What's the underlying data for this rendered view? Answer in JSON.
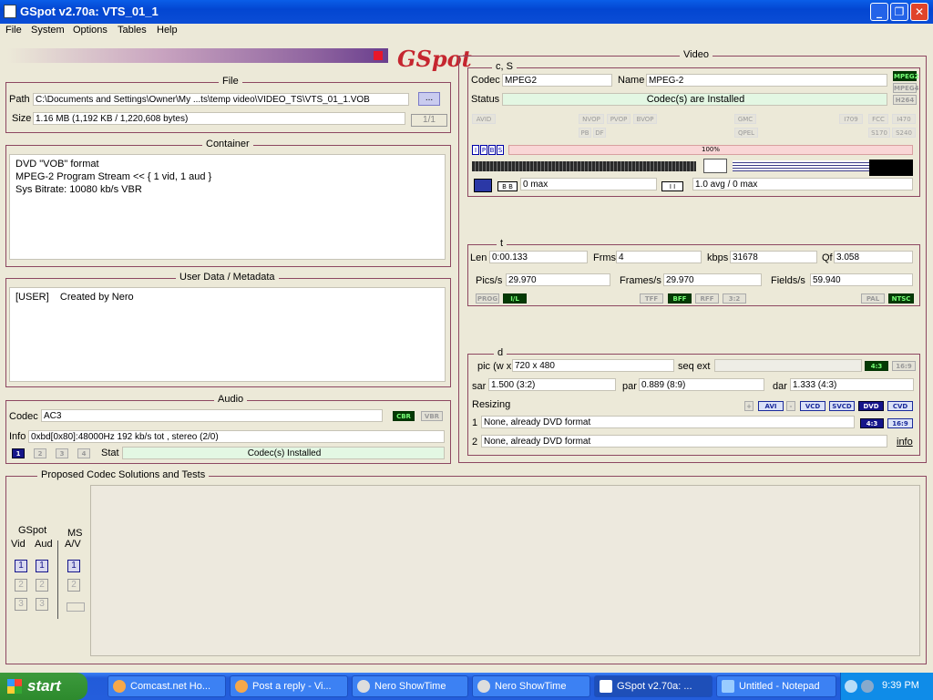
{
  "window": {
    "title": "GSpot v2.70a: VTS_01_1",
    "min": "_",
    "max": "❐",
    "close": "✕"
  },
  "menu": [
    "File",
    "System",
    "Options",
    "Tables",
    "Help"
  ],
  "logo": "GSpot",
  "file": {
    "title": "File",
    "path_label": "Path",
    "path": "C:\\Documents and Settings\\Owner\\My ...ts\\temp video\\VIDEO_TS\\VTS_01_1.VOB",
    "browse": "...",
    "size_label": "Size",
    "size": "1.16 MB (1,192 KB / 1,220,608 bytes)",
    "counter": "1/1"
  },
  "container": {
    "title": "Container",
    "text": "DVD \"VOB\" format\nMPEG-2 Program Stream << { 1 vid, 1 aud }\nSys Bitrate: 10080 kb/s VBR"
  },
  "userdata": {
    "title": "User Data / Metadata",
    "text": "[USER]    Created by Nero"
  },
  "audio": {
    "title": "Audio",
    "codec_label": "Codec",
    "codec": "AC3",
    "cbr": "CBR",
    "vbr": "VBR",
    "info_label": "Info",
    "info": "0xbd[0x80]:48000Hz  192 kb/s tot , stereo (2/0)",
    "stat_label": "Stat",
    "stat": "Codec(s) Installed",
    "tracks": [
      "1",
      "2",
      "3",
      "4"
    ]
  },
  "codec_solutions": {
    "title": "Proposed Codec Solutions and Tests",
    "gspot": "GSpot",
    "vid": "Vid",
    "aud": "Aud",
    "ms": "MS",
    "av": "A/V",
    "btns": [
      "1",
      "2",
      "3"
    ]
  },
  "video": {
    "title": "Video",
    "cs_title": "c, S",
    "codec_label": "Codec",
    "codec": "MPEG2",
    "name_label": "Name",
    "name": "MPEG-2",
    "status_label": "Status",
    "status": "Codec(s) are Installed",
    "fmt": [
      "MPEG2",
      "MPEG4",
      "H264"
    ],
    "flags1": [
      "AVID",
      "NVOP",
      "PVOP",
      "BVOP",
      "GMC",
      "I709",
      "FCC",
      "I470"
    ],
    "flags2": [
      "PB",
      "DF",
      "QPEL",
      "S170",
      "S240"
    ],
    "frame_types": [
      "I",
      "P",
      "B",
      "S"
    ],
    "percent": "100%",
    "be": "B B",
    "max1": "0 max",
    "ii": "I I",
    "avg": "1.0 avg / 0 max"
  },
  "timing": {
    "title": "t",
    "len_label": "Len",
    "len": "0:00.133",
    "frms_label": "Frms",
    "frms": "4",
    "kbps_label": "kbps",
    "kbps": "31678",
    "qf_label": "Qf",
    "qf": "3.058",
    "pics_label": "Pics/s",
    "pics": "29.970",
    "frames_label": "Frames/s",
    "frames": "29.970",
    "fields_label": "Fields/s",
    "fields": "59.940",
    "flags": [
      "PROG",
      "I/L",
      "TFF",
      "BFF",
      "RFF",
      "3:2",
      "PAL",
      "NTSC"
    ]
  },
  "dims": {
    "title": "d",
    "pic_label": "pic (w x h)",
    "pic": "720 x 480",
    "seqext_label": "seq ext",
    "ar43": "4:3",
    "ar169": "16:9",
    "sar_label": "sar",
    "sar": "1.500 (3:2)",
    "par_label": "par",
    "par": "0.889 (8:9)",
    "dar_label": "dar",
    "dar": "1.333 (4:3)",
    "resizing_label": "Resizing",
    "plus": "+",
    "avi": "AVI",
    "minus": "-",
    "vcd": "VCD",
    "svcd": "SVCD",
    "dvd": "DVD",
    "cvd": "CVD",
    "r1_num": "1",
    "r1": "None, already DVD format",
    "r2_num": "2",
    "r2": "None, already DVD format",
    "r1_43": "4:3",
    "r1_169": "16:9",
    "info_link": "info"
  },
  "taskbar": {
    "start": "start",
    "items": [
      "Comcast.net Ho...",
      "Post a reply - Vi...",
      "Nero ShowTime",
      "Nero ShowTime",
      "GSpot v2.70a: ...",
      "Untitled - Notepad"
    ],
    "clock": "9:39 PM"
  }
}
